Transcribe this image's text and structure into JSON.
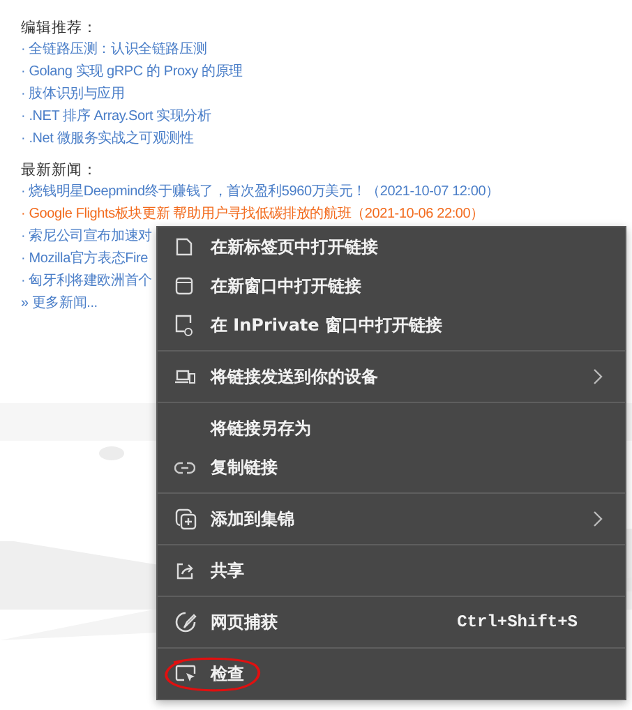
{
  "editor_picks": {
    "title": "编辑推荐：",
    "items": [
      "· 全链路压测：认识全链路压测",
      "· Golang 实现 gRPC 的 Proxy 的原理",
      "· 肢体识别与应用",
      "· .NET 排序 Array.Sort 实现分析",
      "· .Net 微服务实战之可观测性"
    ]
  },
  "latest_news": {
    "title": "最新新闻：",
    "items": [
      {
        "text": "· 烧钱明星Deepmind终于赚钱了，首次盈利5960万美元！（2021-10-07 12:00）",
        "hovered": false
      },
      {
        "text": "· Google Flights板块更新 帮助用户寻找低碳排放的航班（2021-10-06 22:00）",
        "hovered": true
      },
      {
        "text": "· 索尼公司宣布加速对",
        "hovered": false
      },
      {
        "text": "· Mozilla官方表态Fire",
        "hovered": false
      },
      {
        "text": "· 匈牙利将建欧洲首个",
        "hovered": false
      }
    ],
    "more": "» 更多新闻..."
  },
  "context_menu": {
    "groups": [
      [
        {
          "label": "在新标签页中打开链接"
        },
        {
          "label": "在新窗口中打开链接"
        },
        {
          "label": "在 InPrivate 窗口中打开链接"
        }
      ],
      [
        {
          "label": "将链接发送到你的设备",
          "submenu": true
        }
      ],
      [
        {
          "label": "将链接另存为"
        },
        {
          "label": "复制链接"
        }
      ],
      [
        {
          "label": "添加到集锦",
          "submenu": true
        }
      ],
      [
        {
          "label": "共享"
        }
      ],
      [
        {
          "label": "网页捕获",
          "shortcut": "Ctrl+Shift+S"
        }
      ],
      [
        {
          "label": "检查",
          "circled": true
        }
      ]
    ]
  }
}
